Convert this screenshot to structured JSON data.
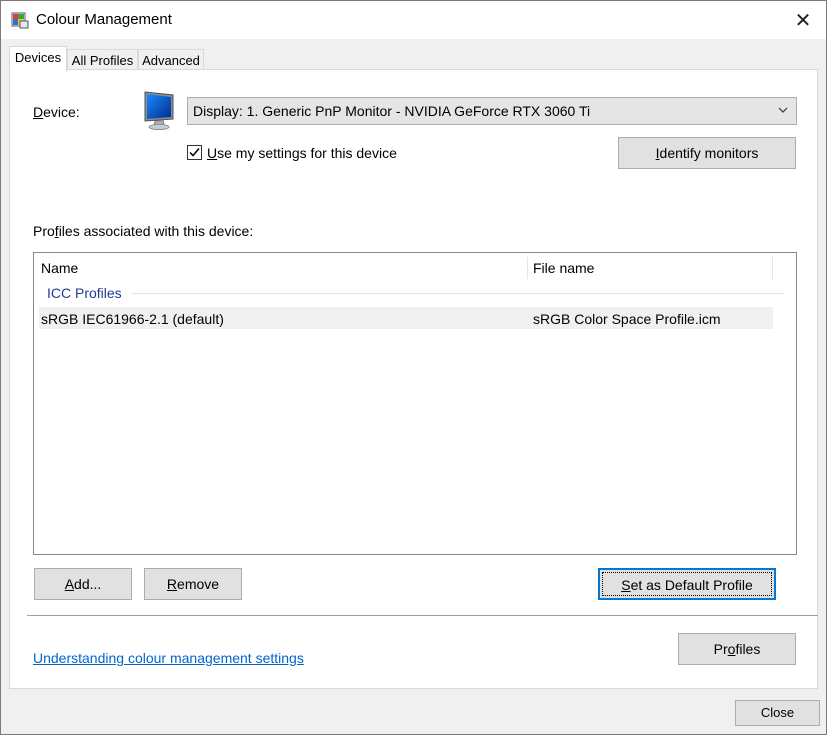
{
  "window": {
    "title": "Colour Management",
    "close_glyph": "✕"
  },
  "tabs": [
    {
      "label": "Devices",
      "active": true
    },
    {
      "label": "All Profiles",
      "active": false
    },
    {
      "label": "Advanced",
      "active": false
    }
  ],
  "device": {
    "label_accel": "D",
    "label_rest": "evice:",
    "selected": "Display: 1. Generic PnP Monitor - NVIDIA GeForce RTX 3060 Ti",
    "icon": "monitor-icon"
  },
  "use_settings": {
    "checked": true,
    "label_accel": "U",
    "label_rest": "se my settings for this device"
  },
  "identify_button": {
    "accel": "I",
    "rest": "dentify monitors"
  },
  "profiles_label": {
    "pre": "Pro",
    "accel": "f",
    "post": "iles associated with this device:"
  },
  "list": {
    "columns": [
      "Name",
      "File name"
    ],
    "group": "ICC Profiles",
    "rows": [
      {
        "name": "sRGB IEC61966-2.1 (default)",
        "file": "sRGB Color Space Profile.icm"
      }
    ]
  },
  "buttons": {
    "add": {
      "accel": "A",
      "rest": "dd..."
    },
    "remove": {
      "accel": "R",
      "rest": "emove"
    },
    "set_default": {
      "accel": "S",
      "rest": "et as Default Profile"
    },
    "profiles": {
      "pre": "Pr",
      "accel": "o",
      "post": "files"
    },
    "close": "Close"
  },
  "help_link": "Understanding colour management settings",
  "colors": {
    "link": "#0066cc",
    "group_header": "#1e3c96",
    "focus_border": "#0078d7"
  }
}
